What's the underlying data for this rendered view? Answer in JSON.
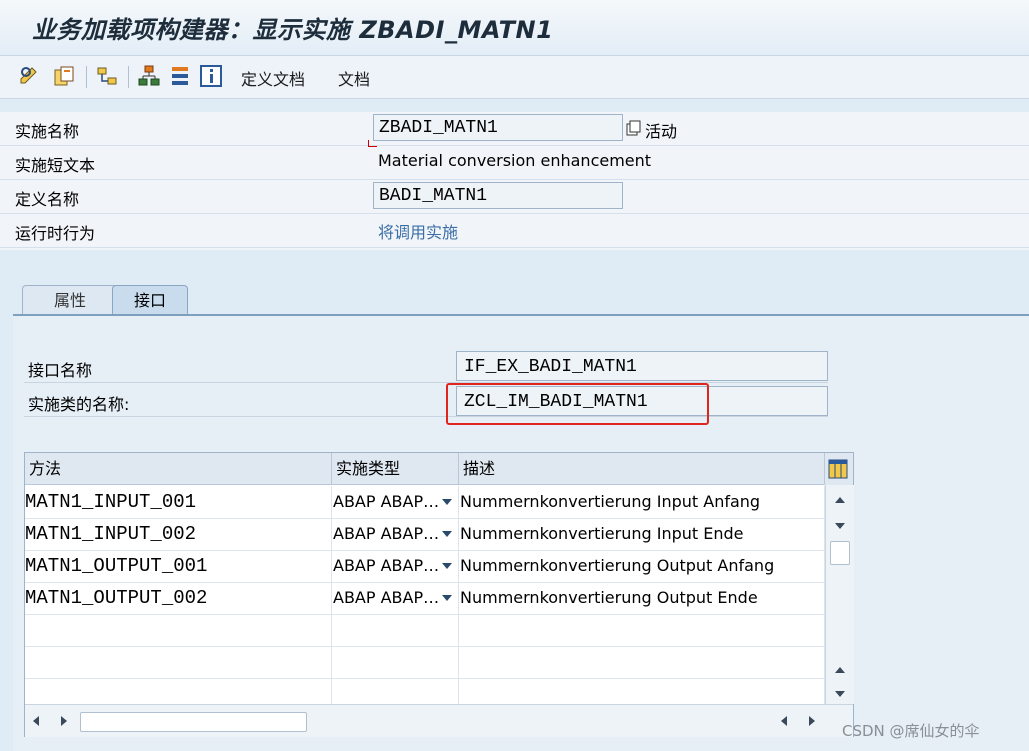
{
  "window": {
    "title": "业务加载项构建器：显示实施 ZBADI_MATN1"
  },
  "toolbar": {
    "define_doc_label": "定义文档",
    "doc_label": "文档"
  },
  "header": {
    "impl_name_label": "实施名称",
    "impl_name_value": "ZBADI_MATN1",
    "impl_status": "活动",
    "short_text_label": "实施短文本",
    "short_text_value": "Material conversion enhancement",
    "def_name_label": "定义名称",
    "def_name_value": "BADI_MATN1",
    "runtime_label": "运行时行为",
    "runtime_value": "将调用实施"
  },
  "tabs": [
    {
      "label": "属性"
    },
    {
      "label": "接口"
    }
  ],
  "interface": {
    "name_label": "接口名称",
    "name_value": "IF_EX_BADI_MATN1",
    "class_label": "实施类的名称:",
    "class_value": "ZCL_IM_BADI_MATN1"
  },
  "grid": {
    "columns": [
      "方法",
      "实施类型",
      "描述"
    ],
    "rows": [
      {
        "method": "MATN1_INPUT_001",
        "type": "ABAP ABAP…",
        "desc": "Nummernkonvertierung Input Anfang"
      },
      {
        "method": "MATN1_INPUT_002",
        "type": "ABAP ABAP…",
        "desc": "Nummernkonvertierung Input Ende"
      },
      {
        "method": "MATN1_OUTPUT_001",
        "type": "ABAP ABAP…",
        "desc": "Nummernkonvertierung Output Anfang"
      },
      {
        "method": "MATN1_OUTPUT_002",
        "type": "ABAP ABAP…",
        "desc": "Nummernkonvertierung Output Ende"
      }
    ]
  },
  "watermark": "CSDN @席仙女的伞",
  "colors": {
    "highlight": "#e0261c",
    "link": "#3b6ea5",
    "background": "#dfebf5"
  }
}
